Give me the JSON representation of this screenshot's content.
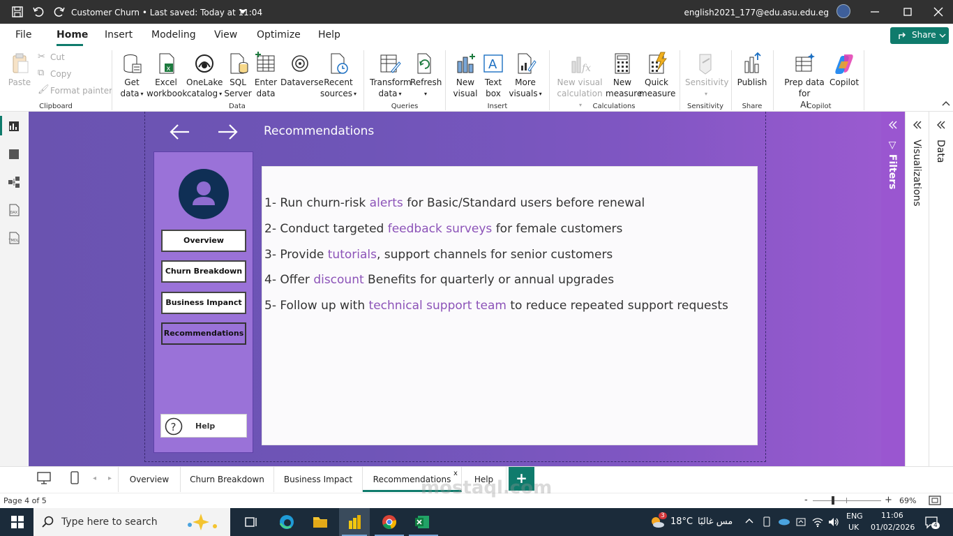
{
  "window": {
    "title": "Customer Churn • Last saved: Today at 11:04",
    "user": "english2021_177@edu.asu.edu.eg"
  },
  "menu": {
    "items": [
      "File",
      "Home",
      "Insert",
      "Modeling",
      "View",
      "Optimize",
      "Help"
    ],
    "active": "Home",
    "share": "Share"
  },
  "ribbon": {
    "clipboard": {
      "paste": "Paste",
      "cut": "Cut",
      "copy": "Copy",
      "format_painter": "Format painter",
      "label": "Clipboard"
    },
    "data": {
      "get_data": [
        "Get",
        "data"
      ],
      "excel": [
        "Excel",
        "workbook"
      ],
      "onelake": [
        "OneLake",
        "catalog"
      ],
      "sql": [
        "SQL",
        "Server"
      ],
      "enter": [
        "Enter",
        "data"
      ],
      "dataverse": "Dataverse",
      "recent": [
        "Recent",
        "sources"
      ],
      "label": "Data"
    },
    "queries": {
      "transform": [
        "Transform",
        "data"
      ],
      "refresh": "Refresh",
      "label": "Queries"
    },
    "insert": {
      "new_visual": [
        "New",
        "visual"
      ],
      "text_box": [
        "Text",
        "box"
      ],
      "more_visuals": [
        "More",
        "visuals"
      ],
      "label": "Insert"
    },
    "calculations": {
      "new_visual_calc": [
        "New visual",
        "calculation"
      ],
      "new_measure": [
        "New",
        "measure"
      ],
      "quick_measure": [
        "Quick",
        "measure"
      ],
      "label": "Calculations"
    },
    "sensitivity": {
      "btn": "Sensitivity",
      "label": "Sensitivity"
    },
    "share": {
      "publish": "Publish",
      "label": "Share"
    },
    "copilot": {
      "prep": [
        "Prep data for",
        "AI"
      ],
      "copilot": "Copilot",
      "label": "Copilot"
    }
  },
  "report": {
    "heading": "Recommendations",
    "side_nav": [
      "Overview",
      "Churn Breakdown",
      "Business Impanct",
      "Recommendations"
    ],
    "help": "Help",
    "recommendations": [
      {
        "pre": "1- Run churn-risk ",
        "hl": "alerts",
        "post": " for Basic/Standard users before renewal"
      },
      {
        "pre": "2- Conduct targeted ",
        "hl": "feedback surveys",
        "post": " for female customers"
      },
      {
        "pre": "3- Provide ",
        "hl": "tutorials",
        "post": ", support channels for senior customers"
      },
      {
        "pre": "4- Offer ",
        "hl": "discount",
        "post": " Benefits for quarterly or annual upgrades"
      },
      {
        "pre": "5- Follow up with ",
        "hl": "technical support team",
        "post": " to reduce repeated support requests"
      }
    ]
  },
  "panes": {
    "filters": "Filters",
    "visualizations": "Visualizations",
    "data": "Data"
  },
  "tabs": {
    "pages": [
      "Overview",
      "Churn Breakdown",
      "Business Impact",
      "Recommendations",
      "Help"
    ],
    "active": "Recommendations",
    "close": "x",
    "add": "+"
  },
  "status": {
    "page": "Page 4 of 5",
    "zoom": "69%",
    "zoom_minus": "-",
    "zoom_plus": "+"
  },
  "taskbar": {
    "search_placeholder": "Type here to search",
    "weather": "18°C",
    "weather_text": "مس غالبًا",
    "lang1": "ENG",
    "lang2": "UK",
    "time": "11:06",
    "date": "01/02/2026",
    "notifications": "4",
    "weather_badge": "3"
  },
  "colors": {
    "accent": "#0f7b6c",
    "highlight": "#8c53b8",
    "canvas": "#6f55b8",
    "side_panel": "#9a72d8",
    "profile": "#0f2f55"
  }
}
